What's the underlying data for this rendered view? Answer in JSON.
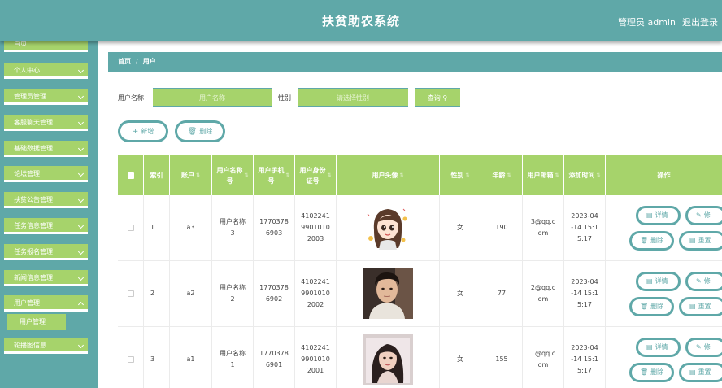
{
  "header": {
    "title": "扶贫助农系统",
    "user": "管理员 admin",
    "logout": "退出登录"
  },
  "sidebar": {
    "items": [
      {
        "label": "首页"
      },
      {
        "label": "个人中心"
      },
      {
        "label": "管理员管理"
      },
      {
        "label": "客服聊天管理"
      },
      {
        "label": "基础数据管理"
      },
      {
        "label": "论坛管理"
      },
      {
        "label": "扶贫公告管理"
      },
      {
        "label": "任务信息管理"
      },
      {
        "label": "任务报名管理"
      },
      {
        "label": "新闻信息管理"
      },
      {
        "label": "用户管理"
      },
      {
        "label": "轮播图信息"
      }
    ],
    "sub_item": "用户管理"
  },
  "breadcrumb": {
    "home": "首页",
    "sep": "/",
    "current": "用户"
  },
  "search": {
    "name_label": "用户名称",
    "name_placeholder": "用户名称",
    "gender_label": "性别",
    "gender_placeholder": "请选择性别",
    "query_label": "查询",
    "query_icon": "search-icon"
  },
  "actions": {
    "add_label": "新增",
    "delete_label": "删除"
  },
  "table": {
    "headers": [
      "索引",
      "账户",
      "用户名称",
      "用户手机号",
      "用户身份证号",
      "用户头像",
      "性别",
      "年龄",
      "用户邮箱",
      "添加时间",
      "操作"
    ],
    "headers_display": [
      "索引",
      "账户",
      "用户名称\n号",
      "用户手机\n号",
      "用户身份\n证号",
      "用户头像",
      "性别",
      "年龄",
      "用户邮箱",
      "添加时间",
      "操作"
    ],
    "sort_mark": "⇅",
    "rows": [
      {
        "index": "1",
        "account": "a3",
        "name": "用户名称\n3",
        "phone": "1770378\n6903",
        "idcard": "4102241\n9901010\n2003",
        "gender": "女",
        "age": "190",
        "email": "3@qq.c\nom",
        "time": "2023-04\n-14 15:1\n5:17"
      },
      {
        "index": "2",
        "account": "a2",
        "name": "用户名称\n2",
        "phone": "1770378\n6902",
        "idcard": "4102241\n9901010\n2002",
        "gender": "女",
        "age": "77",
        "email": "2@qq.c\nom",
        "time": "2023-04\n-14 15:1\n5:17"
      },
      {
        "index": "3",
        "account": "a1",
        "name": "用户名称\n1",
        "phone": "1770378\n6901",
        "idcard": "4102241\n9901010\n2001",
        "gender": "女",
        "age": "155",
        "email": "1@qq.c\nom",
        "time": "2023-04\n-14 15:1\n5:17"
      }
    ],
    "op": {
      "detail": "详情",
      "edit": "修",
      "delete": "删除",
      "reset": "重置"
    }
  },
  "colors": {
    "teal": "#5fa8a8",
    "green": "#a6d36b"
  }
}
